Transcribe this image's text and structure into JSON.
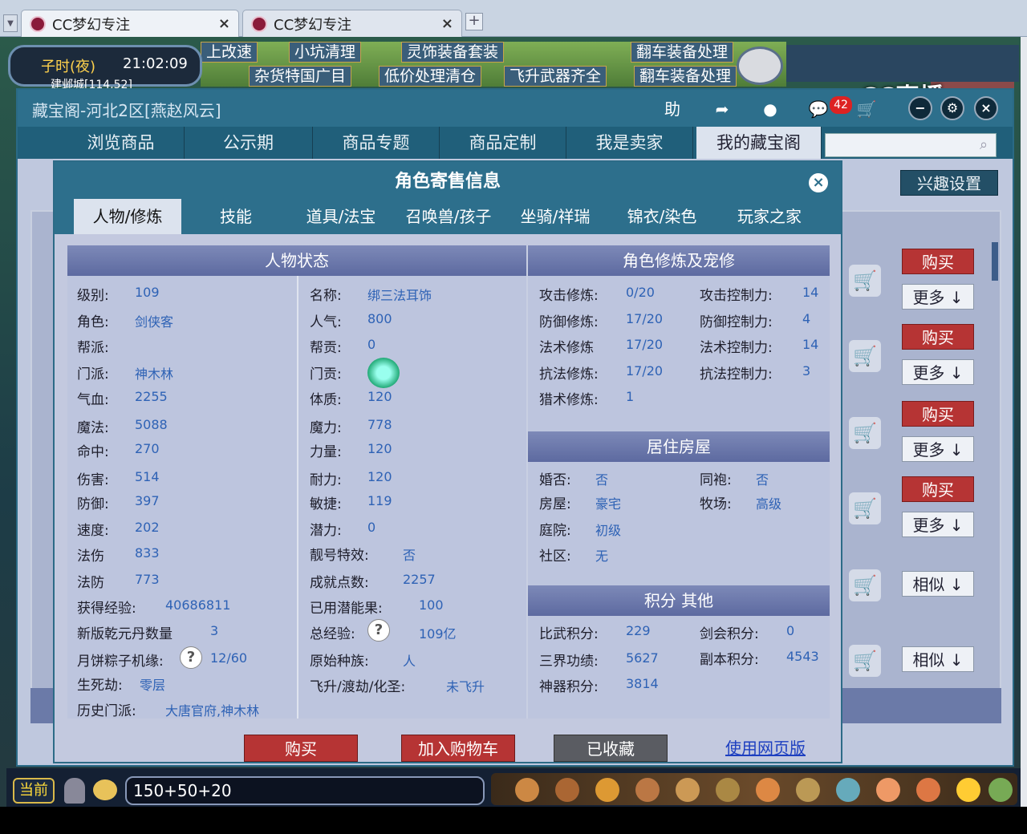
{
  "browser": {
    "tabs": [
      {
        "label": "CC梦幻专注",
        "close": "×"
      },
      {
        "label": "CC梦幻专注",
        "close": "×"
      }
    ],
    "new_tab": "+"
  },
  "game_hud": {
    "shichen": "子时(夜)",
    "time": "21:02:09",
    "location": "建邺城[114,52]",
    "ads": [
      "上改速",
      "小坑清理",
      "灵饰装备套装",
      "翻车装备处理",
      "杂货特国广目",
      "低价处理清仓",
      "飞升武器齐全",
      "翻车装备处理"
    ],
    "stream_logo": "CC直播"
  },
  "window": {
    "title": "藏宝阁-河北2区[燕赵风云]",
    "help": "助",
    "cart_count": "42",
    "nav_tabs": [
      "浏览商品",
      "公示期",
      "商品专题",
      "商品定制",
      "我是卖家",
      "我的藏宝阁"
    ],
    "interest_btn": "兴趣设置",
    "side_buttons": {
      "buy": "购买",
      "more": "更多",
      "similar": "相似"
    }
  },
  "dialog": {
    "title": "角色寄售信息",
    "tabs": [
      "人物/修炼",
      "技能",
      "道具/法宝",
      "召唤兽/孩子",
      "坐骑/祥瑞",
      "锦衣/染色",
      "玩家之家"
    ],
    "status_header": "人物状态",
    "status_left": [
      {
        "label": "级别:",
        "value": "109"
      },
      {
        "label": "角色:",
        "value": "剑侠客"
      },
      {
        "label": "帮派:",
        "value": ""
      },
      {
        "label": "门派:",
        "value": "神木林"
      },
      {
        "label": "气血:",
        "value": "2255"
      },
      {
        "label": "魔法:",
        "value": "5088"
      },
      {
        "label": "命中:",
        "value": "270"
      },
      {
        "label": "伤害:",
        "value": "514"
      },
      {
        "label": "防御:",
        "value": "397"
      },
      {
        "label": "速度:",
        "value": "202"
      },
      {
        "label": "法伤",
        "value": "833"
      },
      {
        "label": "法防",
        "value": "773"
      }
    ],
    "status_right": [
      {
        "label": "名称:",
        "value": "绑三法耳饰"
      },
      {
        "label": "人气:",
        "value": "800"
      },
      {
        "label": "帮贡:",
        "value": "0"
      },
      {
        "label": "门贡:",
        "value": ""
      },
      {
        "label": "体质:",
        "value": "120"
      },
      {
        "label": "魔力:",
        "value": "778"
      },
      {
        "label": "力量:",
        "value": "120"
      },
      {
        "label": "耐力:",
        "value": "120"
      },
      {
        "label": "敏捷:",
        "value": "119"
      },
      {
        "label": "潜力:",
        "value": "0"
      },
      {
        "label": "靓号特效:",
        "value": "否"
      },
      {
        "label": "成就点数:",
        "value": "2257"
      }
    ],
    "extra_left": [
      {
        "label": "获得经验:",
        "value": "40686811"
      },
      {
        "label": "新版乾元丹数量",
        "value": "3"
      },
      {
        "label": "月饼粽子机缘:",
        "value": "12/60"
      },
      {
        "label": "生死劫:",
        "value": "零层"
      },
      {
        "label": "历史门派:",
        "value": "大唐官府,神木林"
      }
    ],
    "extra_right": [
      {
        "label": "已用潜能果:",
        "value": "100"
      },
      {
        "label": "总经验:",
        "value": "109亿"
      },
      {
        "label": "原始种族:",
        "value": "人"
      },
      {
        "label": "飞升/渡劫/化圣:",
        "value": "未飞升"
      }
    ],
    "cultivation_header": "角色修炼及宠修",
    "cultivation": [
      {
        "label": "攻击修炼:",
        "value": "0/20",
        "label2": "攻击控制力:",
        "value2": "14"
      },
      {
        "label": "防御修炼:",
        "value": "17/20",
        "label2": "防御控制力:",
        "value2": "4"
      },
      {
        "label": "法术修炼",
        "value": "17/20",
        "label2": "法术控制力:",
        "value2": "14"
      },
      {
        "label": "抗法修炼:",
        "value": "17/20",
        "label2": "抗法控制力:",
        "value2": "3"
      },
      {
        "label": "猎术修炼:",
        "value": "1",
        "label2": "",
        "value2": ""
      }
    ],
    "house_header": "居住房屋",
    "house": [
      {
        "label": "婚否:",
        "value": "否",
        "label2": "同袍:",
        "value2": "否"
      },
      {
        "label": "房屋:",
        "value": "豪宅",
        "label2": "牧场:",
        "value2": "高级"
      },
      {
        "label": "庭院:",
        "value": "初级",
        "label2": "",
        "value2": ""
      },
      {
        "label": "社区:",
        "value": "无",
        "label2": "",
        "value2": ""
      }
    ],
    "score_header": "积分 其他",
    "scores": [
      {
        "label": "比武积分:",
        "value": "229",
        "label2": "剑会积分:",
        "value2": "0"
      },
      {
        "label": "三界功绩:",
        "value": "5627",
        "label2": "副本积分:",
        "value2": "4543"
      },
      {
        "label": "神器积分:",
        "value": "3814",
        "label2": "",
        "value2": ""
      }
    ],
    "buttons": {
      "buy": "购买",
      "add_cart": "加入购物车",
      "favorited": "已收藏",
      "web": "使用网页版"
    }
  },
  "chat": {
    "channel": "当前",
    "input_value": "150+50+20"
  },
  "colors": {
    "header_teal": "#2d6f8c",
    "buy_red": "#b63434",
    "value_blue": "#2e62b5"
  }
}
